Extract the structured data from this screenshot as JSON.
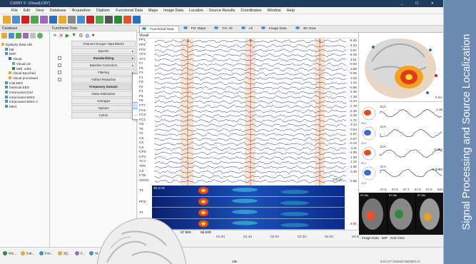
{
  "window": {
    "title": "CURRY 9 - [Visual].CRY]",
    "controls": "_ ☐ ✕",
    "menu": [
      "File",
      "Edit",
      "View",
      "Database",
      "Acquisition",
      "Digitizer",
      "Functional Data",
      "Maps",
      "Image Data",
      "Localize",
      "Source Results",
      "Coordinates",
      "Window",
      "Help"
    ]
  },
  "database": {
    "header": "Database",
    "tree": [
      {
        "label": "Epilepsy Data.cdb",
        "level": 0
      },
      {
        "label": "DB",
        "level": 1
      },
      {
        "label": "ERP",
        "level": 1
      },
      {
        "label": "Visual",
        "level": 2
      },
      {
        "label": "Visual.cnt",
        "level": 3
      },
      {
        "label": "MRI: sdirs",
        "level": 3
      },
      {
        "label": "Visual Epoched",
        "level": 2
      },
      {
        "label": "Visual processed",
        "level": 2
      },
      {
        "label": "Ictal EEG",
        "level": 1
      },
      {
        "label": "Interictal EEG",
        "level": 1
      },
      {
        "label": "Intracranial Grid",
        "level": 1
      },
      {
        "label": "Intracranial sEEG",
        "level": 1
      },
      {
        "label": "Intracranial sEEG 2",
        "level": 1
      },
      {
        "label": "MEG",
        "level": 1
      }
    ]
  },
  "functional": {
    "header": "Functional Data",
    "items": [
      {
        "label": "Channel Groups / Bad Blocks",
        "bold": false,
        "check": false,
        "arrow": false
      },
      {
        "label": "Epochs",
        "bold": false,
        "check": false,
        "arrow": true
      },
      {
        "label": "Standardizing",
        "bold": true,
        "check": true,
        "arrow": true
      },
      {
        "label": "Baseline Correction",
        "bold": false,
        "check": true,
        "arrow": true
      },
      {
        "label": "Filtering",
        "bold": false,
        "check": true,
        "arrow": true
      },
      {
        "label": "Artifact Reduction",
        "bold": false,
        "check": true,
        "arrow": true
      },
      {
        "label": "Frequency Domain",
        "bold": true,
        "check": false,
        "arrow": false
      },
      {
        "label": "Noise Estimation",
        "bold": false,
        "check": false,
        "arrow": false
      },
      {
        "label": "Averages",
        "bold": false,
        "check": false,
        "arrow": false
      },
      {
        "label": "Options",
        "bold": false,
        "check": false,
        "arrow": false
      },
      {
        "label": "Colors",
        "bold": false,
        "check": false,
        "arrow": false
      }
    ]
  },
  "context_menu": {
    "items": [
      "Add Baselineserving",
      "Add Baseline Correction",
      "Add Filtering",
      "Add Template Matching",
      "Add Seizure / Spike Detection",
      "Add Artifact Reduction",
      "Add Miscellaneous",
      "Remove"
    ],
    "selected_index": 5
  },
  "view_tabs": [
    "Functional Data",
    "FD: Maps",
    "FD: All",
    "All",
    "Image Data",
    "3D View"
  ],
  "eeg": {
    "title": "Visual",
    "markers": [
      "1",
      "1",
      "1"
    ],
    "channels": [
      {
        "name": "FP1",
        "value": "-8.45"
      },
      {
        "name": "FPZ",
        "value": "-4.64"
      },
      {
        "name": "FP2",
        "value": "0.67"
      },
      {
        "name": "AF3",
        "value": "-8.49"
      },
      {
        "name": "AF4",
        "value": "4.51"
      },
      {
        "name": "F7",
        "value": "0.93"
      },
      {
        "name": "F5",
        "value": "3.88"
      },
      {
        "name": "F3",
        "value": "-0.05"
      },
      {
        "name": "F1",
        "value": "3.32"
      },
      {
        "name": "FZ",
        "value": "1.12"
      },
      {
        "name": "F2",
        "value": "-0.98"
      },
      {
        "name": "F4",
        "value": "3.36"
      },
      {
        "name": "F6",
        "value": "-7.36"
      },
      {
        "name": "F8",
        "value": "-2.24"
      },
      {
        "name": "FT7",
        "value": "-1.79"
      },
      {
        "name": "FC5",
        "value": "-2.15"
      },
      {
        "name": "FC3",
        "value": "0.28"
      },
      {
        "name": "FC1",
        "value": "2.72"
      },
      {
        "name": "O2",
        "value": "3.13"
      },
      {
        "name": "T8",
        "value": "0.64"
      },
      {
        "name": "T4",
        "value": "-1.87"
      },
      {
        "name": "C5",
        "value": "0.67"
      },
      {
        "name": "C2",
        "value": "-0.23"
      },
      {
        "name": "C3",
        "value": "4.11"
      },
      {
        "name": "CPZ",
        "value": "-1.90"
      },
      {
        "name": "CP4",
        "value": "1.88"
      },
      {
        "name": "TC4",
        "value": "1.12"
      },
      {
        "name": "TP8",
        "value": "-1.90"
      },
      {
        "name": "CZ",
        "value": "0.39"
      },
      {
        "name": "F7B",
        "value": ""
      }
    ],
    "veog": {
      "name": "VEOG",
      "value": "-2.85"
    },
    "scale": "100 μV"
  },
  "tf": {
    "freq_label": "25.3 Hz",
    "channels": [
      {
        "name": "T3",
        "value": ""
      },
      {
        "name": "FPZ",
        "value": ""
      },
      {
        "name": "T4",
        "value": ""
      },
      {
        "name": "O2",
        "value": "3.91"
      }
    ]
  },
  "time": {
    "left": "57.500",
    "mid": "58.000",
    "ticks": [
      "01:20",
      "01:40",
      "02:00",
      "02:20",
      "02:40",
      "03:00"
    ]
  },
  "ica": {
    "labels": [
      "ICA",
      "ICA",
      "ICA",
      "ICA"
    ],
    "values": [
      "1.16",
      "",
      "0.262",
      "-0.0482"
    ],
    "axis": [
      "57.5",
      "57.6",
      "57.7",
      "57.8",
      "57.9",
      "58.0"
    ],
    "side_values": [
      "25.0",
      "23.0",
      "25.1",
      "12.5"
    ]
  },
  "brain_label": "3.64",
  "mri_labels": [
    "57.5ts",
    "57.5ts",
    "57.5ts"
  ],
  "right_tabs": [
    "Image Data",
    "MIP",
    "Grid View"
  ],
  "status": {
    "tasks": [
      "Wo...",
      "Dat...",
      "Fun...",
      "3D...",
      "F...",
      "M..."
    ],
    "idle": "Idle",
    "version": "9.0.0.27 ASSAD-VBCER1-G"
  },
  "banner": "Signal Processing and Source Localization",
  "colors": {
    "banner": "#6a8ab1",
    "title": "#1f3b5e",
    "trace": "#1e2f8c",
    "highlight": "#f6c68e"
  }
}
